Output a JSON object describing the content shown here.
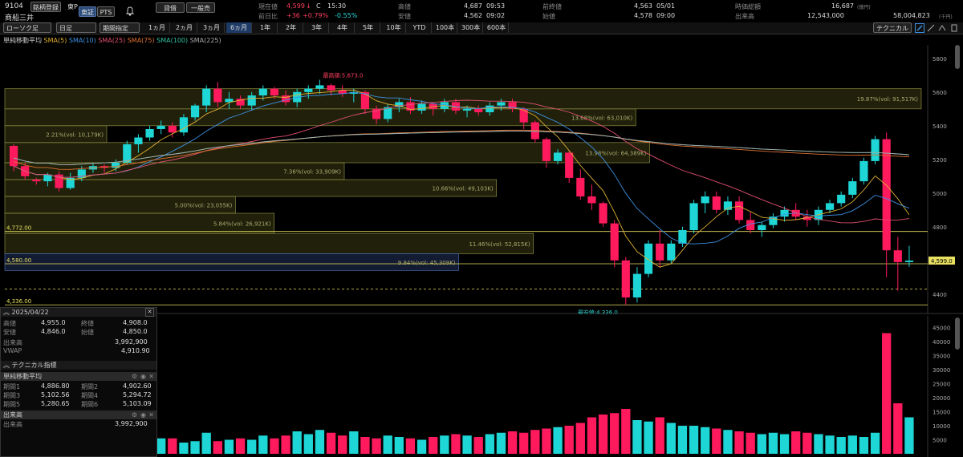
{
  "header": {
    "code": "9104",
    "name": "商船三井",
    "register_btn": "銘柄登録",
    "market_label": "東P",
    "exchange_btn": "東証",
    "pts_btn": "PTS",
    "borrow_btn": "貸借",
    "margin_btn": "一般売",
    "current_label": "現在値",
    "current_value": "4,599",
    "current_arrow": "↓",
    "current_flag": "C",
    "current_time": "15:30",
    "change_label": "前日比",
    "change_value": "+36",
    "change_pct": "+0.79%",
    "change_pct2": "-0.55%",
    "high_label": "高値",
    "high_value": "4,687",
    "high_time": "09:53",
    "low_label": "安値",
    "low_value": "4,562",
    "low_time": "09:02",
    "prev_close_label": "前終値",
    "prev_close_value": "4,563",
    "prev_close_date": "05/01",
    "open_label": "始値",
    "open_value": "4,578",
    "open_time": "09:00",
    "mcap_label": "時価総額",
    "mcap_value": "16,687",
    "mcap_unit": "(億円)",
    "volume_label": "出来高",
    "volume_value": "12,543,000",
    "turnover_value": "58,004,823",
    "turnover_unit": "(千円)"
  },
  "toolbar": {
    "chart_type": "ローソク足",
    "period_type": "日足",
    "range_label": "期間指定",
    "ranges": [
      "1ヵ月",
      "2ヵ月",
      "3ヵ月",
      "6ヵ月",
      "1年",
      "2年",
      "3年",
      "4年",
      "5年",
      "10年",
      "YTD",
      "100本",
      "300本",
      "600本"
    ],
    "active_range": "6ヵ月",
    "technical_btn": "テクニカル"
  },
  "legend": {
    "title": "単純移動平均",
    "items": [
      {
        "label": "SMA(5)",
        "color": "#e0b030"
      },
      {
        "label": "SMA(10)",
        "color": "#3d8fe0"
      },
      {
        "label": "SMA(25)",
        "color": "#e05070"
      },
      {
        "label": "SMA(75)",
        "color": "#e07030"
      },
      {
        "label": "SMA(100)",
        "color": "#30c0a0"
      },
      {
        "label": "SMA(225)",
        "color": "#aaaaaa"
      }
    ]
  },
  "chart_data": {
    "type": "candlestick",
    "y_ticks": [
      5800,
      5600,
      5400,
      5200,
      5000,
      4800,
      4600,
      4400
    ],
    "ylim": [
      4280,
      5880
    ],
    "max_label": "最高値:5,673.0",
    "min_label": "最安値:4,336.0",
    "last_price_label": "4,599.0",
    "h_lines": [
      {
        "label": "4,772.00",
        "value": 4772,
        "color": "#e8e060"
      },
      {
        "label": "4,580.00",
        "value": 4580,
        "color": "#e8e060"
      },
      {
        "label": "4,336.00",
        "value": 4336,
        "color": "#e8e060"
      }
    ],
    "volume_profile": [
      {
        "lo": 5500,
        "hi": 5620,
        "label": "19.87%(vol: 91,517K)"
      },
      {
        "lo": 5400,
        "hi": 5500,
        "label": "13.68%(vol: 63,010K)"
      },
      {
        "lo": 5300,
        "hi": 5400,
        "label": "2.21%(vol: 10,179K)"
      },
      {
        "lo": 5180,
        "hi": 5300,
        "label": "13.98%(vol: 64,389K)"
      },
      {
        "lo": 5080,
        "hi": 5180,
        "label": "7.36%(vol: 33,909K)"
      },
      {
        "lo": 4980,
        "hi": 5080,
        "label": "10.66%(vol: 49,103K)"
      },
      {
        "lo": 4880,
        "hi": 4980,
        "label": "5.00%(vol: 23,055K)"
      },
      {
        "lo": 4760,
        "hi": 4880,
        "label": "5.84%(vol: 26,921K)"
      },
      {
        "lo": 4640,
        "hi": 4760,
        "label": "11.46%(vol: 52,815K)"
      },
      {
        "lo": 4540,
        "hi": 4640,
        "label": "9.84%(vol: 45,309K)"
      }
    ],
    "candles": [
      [
        5280,
        5290,
        5130,
        5160
      ],
      [
        5160,
        5180,
        5080,
        5100
      ],
      [
        5080,
        5090,
        5050,
        5070
      ],
      [
        5070,
        5120,
        5040,
        5110
      ],
      [
        5110,
        5130,
        5010,
        5030
      ],
      [
        5030,
        5120,
        5020,
        5090
      ],
      [
        5090,
        5160,
        5070,
        5140
      ],
      [
        5140,
        5180,
        5120,
        5160
      ],
      [
        5160,
        5170,
        5120,
        5150
      ],
      [
        5150,
        5200,
        5130,
        5180
      ],
      [
        5180,
        5310,
        5170,
        5290
      ],
      [
        5290,
        5350,
        5240,
        5330
      ],
      [
        5330,
        5400,
        5310,
        5380
      ],
      [
        5380,
        5430,
        5350,
        5400
      ],
      [
        5400,
        5420,
        5330,
        5360
      ],
      [
        5360,
        5470,
        5340,
        5450
      ],
      [
        5450,
        5530,
        5430,
        5520
      ],
      [
        5520,
        5640,
        5480,
        5620
      ],
      [
        5620,
        5660,
        5510,
        5540
      ],
      [
        5540,
        5600,
        5500,
        5560
      ],
      [
        5560,
        5580,
        5500,
        5520
      ],
      [
        5520,
        5600,
        5490,
        5580
      ],
      [
        5580,
        5640,
        5550,
        5620
      ],
      [
        5620,
        5630,
        5560,
        5580
      ],
      [
        5580,
        5610,
        5520,
        5540
      ],
      [
        5540,
        5620,
        5510,
        5600
      ],
      [
        5600,
        5640,
        5560,
        5620
      ],
      [
        5620,
        5673,
        5590,
        5640
      ],
      [
        5640,
        5650,
        5580,
        5610
      ],
      [
        5610,
        5640,
        5570,
        5590
      ],
      [
        5590,
        5620,
        5540,
        5600
      ],
      [
        5600,
        5610,
        5470,
        5500
      ],
      [
        5500,
        5520,
        5410,
        5440
      ],
      [
        5440,
        5530,
        5420,
        5510
      ],
      [
        5510,
        5560,
        5480,
        5540
      ],
      [
        5540,
        5570,
        5470,
        5490
      ],
      [
        5490,
        5550,
        5470,
        5530
      ],
      [
        5530,
        5540,
        5460,
        5500
      ],
      [
        5500,
        5560,
        5480,
        5540
      ],
      [
        5540,
        5560,
        5470,
        5490
      ],
      [
        5490,
        5520,
        5450,
        5500
      ],
      [
        5500,
        5520,
        5460,
        5480
      ],
      [
        5480,
        5540,
        5460,
        5520
      ],
      [
        5520,
        5560,
        5490,
        5540
      ],
      [
        5540,
        5560,
        5480,
        5500
      ],
      [
        5500,
        5510,
        5380,
        5420
      ],
      [
        5420,
        5430,
        5300,
        5320
      ],
      [
        5320,
        5330,
        5150,
        5190
      ],
      [
        5190,
        5260,
        5170,
        5240
      ],
      [
        5240,
        5250,
        5060,
        5090
      ],
      [
        5090,
        5140,
        4960,
        4980
      ],
      [
        4980,
        5050,
        4900,
        4940
      ],
      [
        4940,
        4950,
        4800,
        4820
      ],
      [
        4820,
        4840,
        4560,
        4600
      ],
      [
        4600,
        4620,
        4336,
        4380
      ],
      [
        4380,
        4560,
        4350,
        4520
      ],
      [
        4520,
        4720,
        4500,
        4700
      ],
      [
        4700,
        4780,
        4560,
        4600
      ],
      [
        4600,
        4720,
        4580,
        4700
      ],
      [
        4700,
        4800,
        4680,
        4780
      ],
      [
        4780,
        4960,
        4760,
        4940
      ],
      [
        4940,
        5010,
        4880,
        4980
      ],
      [
        4980,
        5010,
        4880,
        4900
      ],
      [
        4900,
        4980,
        4870,
        4950
      ],
      [
        4950,
        4980,
        4820,
        4840
      ],
      [
        4840,
        4890,
        4760,
        4780
      ],
      [
        4780,
        4830,
        4740,
        4810
      ],
      [
        4810,
        4880,
        4790,
        4860
      ],
      [
        4860,
        4920,
        4830,
        4900
      ],
      [
        4900,
        4940,
        4840,
        4860
      ],
      [
        4860,
        4900,
        4800,
        4840
      ],
      [
        4840,
        4920,
        4810,
        4900
      ],
      [
        4900,
        4960,
        4880,
        4940
      ],
      [
        4940,
        5010,
        4920,
        4990
      ],
      [
        4990,
        5090,
        4970,
        5070
      ],
      [
        5070,
        5210,
        5050,
        5190
      ],
      [
        5190,
        5340,
        5170,
        5320
      ],
      [
        5320,
        5360,
        4500,
        4660
      ],
      [
        4660,
        4740,
        4420,
        4590
      ],
      [
        4590,
        4687,
        4562,
        4599
      ]
    ],
    "volume_y_ticks": [
      45000,
      40000,
      35000,
      30000,
      25000,
      20000,
      15000,
      10000,
      5000
    ],
    "volume_ylim": [
      0,
      48000
    ],
    "volumes": [
      7000,
      5500,
      4500,
      5000,
      6000,
      7500,
      5000,
      5000,
      4500,
      5000,
      5000,
      4500,
      6000,
      5500,
      5500,
      4000,
      4500,
      7500,
      4500,
      5000,
      5500,
      5000,
      6500,
      5500,
      6500,
      8000,
      7000,
      8500,
      7500,
      6500,
      8000,
      6000,
      5500,
      6500,
      6000,
      5500,
      5000,
      6000,
      6500,
      7000,
      6500,
      6000,
      7000,
      7500,
      8000,
      7500,
      8500,
      9000,
      9500,
      10000,
      11000,
      13000,
      14000,
      14500,
      16000,
      12000,
      11500,
      13000,
      11000,
      10000,
      10000,
      9500,
      9000,
      8500,
      8000,
      7500,
      7000,
      7500,
      7000,
      8000,
      7500,
      7000,
      6500,
      6000,
      6500,
      6000,
      7500,
      43000,
      18000,
      13000
    ]
  },
  "left_panel": {
    "date": "2025/04/22",
    "rows": [
      {
        "l1": "高値",
        "v1": "4,955.0",
        "l2": "終値",
        "v2": "4,908.0"
      },
      {
        "l1": "安値",
        "v1": "4,846.0",
        "l2": "始値",
        "v2": "4,850.0"
      }
    ],
    "volume_label": "出来高",
    "volume_value": "3,992,900",
    "vwap_label": "VWAP",
    "vwap_value": "4,910.90",
    "tech_title": "テクニカル指標",
    "sma_title": "単純移動平均",
    "sma_rows": [
      {
        "l1": "期間1",
        "v1": "4,886.80",
        "l2": "期間2",
        "v2": "4,902.60"
      },
      {
        "l1": "期間3",
        "v1": "5,102.56",
        "l2": "期間4",
        "v2": "5,294.72"
      },
      {
        "l1": "期間5",
        "v1": "5,280.65",
        "l2": "期間6",
        "v2": "5,103.09"
      }
    ],
    "vol_title": "出来高",
    "vol_row_label": "出来高",
    "vol_row_value": "3,992,900"
  }
}
